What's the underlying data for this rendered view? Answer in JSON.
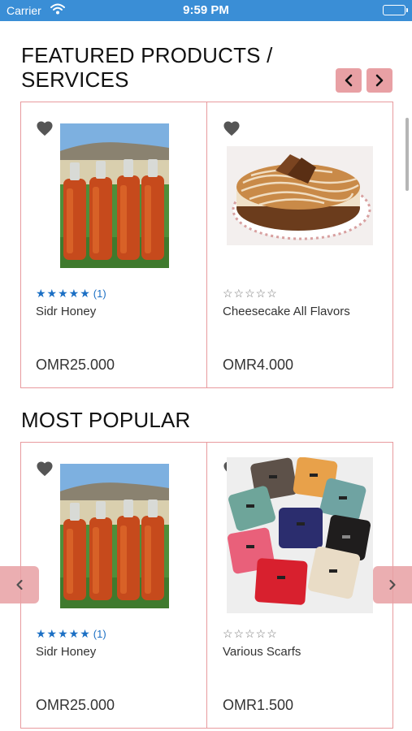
{
  "status_bar": {
    "carrier": "Carrier",
    "time": "9:59 PM"
  },
  "featured": {
    "title": "FEATURED PRODUCTS / SERVICES",
    "products": [
      {
        "name": "Sidr Honey",
        "stars": "★★★★★",
        "rating_count": "(1)",
        "rated": true,
        "price": "OMR25.000",
        "image": "honey-bottles"
      },
      {
        "name": "Cheesecake All Flavors",
        "stars": "☆☆☆☆☆",
        "rating_count": "",
        "rated": false,
        "price": "OMR4.000",
        "image": "cheesecake"
      }
    ]
  },
  "popular": {
    "title": "MOST POPULAR",
    "products": [
      {
        "name": "Sidr Honey",
        "stars": "★★★★★",
        "rating_count": "(1)",
        "rated": true,
        "price": "OMR25.000",
        "image": "honey-bottles"
      },
      {
        "name": "Various Scarfs",
        "stars": "☆☆☆☆☆",
        "rating_count": "",
        "rated": false,
        "price": "OMR1.500",
        "image": "scarves"
      }
    ]
  },
  "colors": {
    "accent": "#e8a0a4",
    "card_border": "#e89a9e",
    "star_blue": "#1b6fc4",
    "status_bar": "#3a8ed6"
  }
}
